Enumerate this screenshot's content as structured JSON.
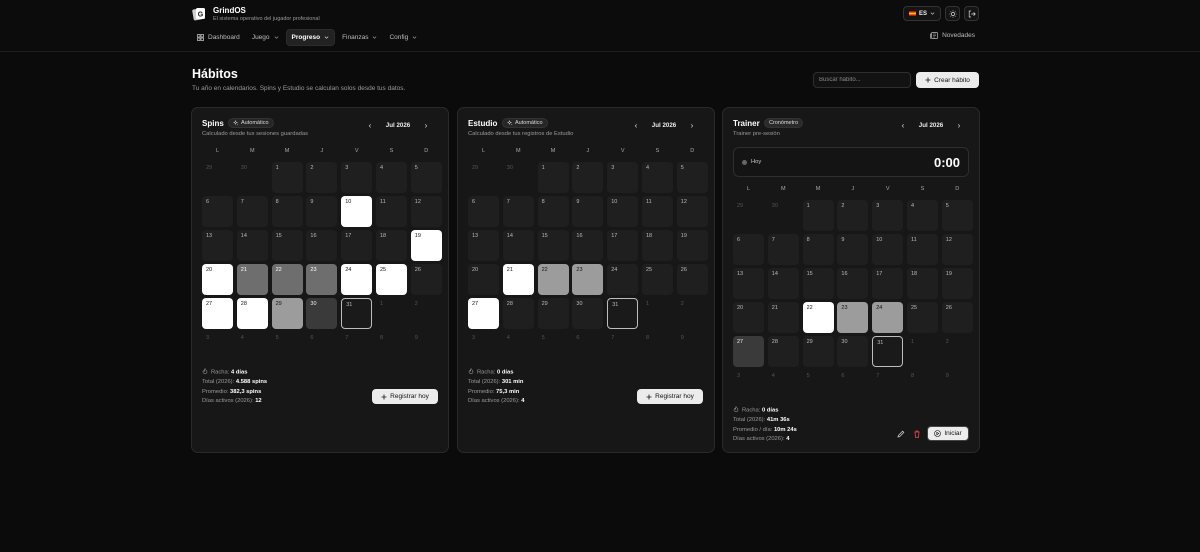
{
  "header": {
    "brand": "GrindOS",
    "tagline": "El sistema operativo del jugador profesional",
    "nav": [
      {
        "label": "Dashboard"
      },
      {
        "label": "Juego"
      },
      {
        "label": "Progreso"
      },
      {
        "label": "Finanzas"
      },
      {
        "label": "Config"
      }
    ],
    "active_nav": "Progreso",
    "language": "ES",
    "news_label": "Novedades"
  },
  "page": {
    "title": "Hábitos",
    "subtitle": "Tu año en calendarios. Spins y Estudio se calculan solos desde tus datos.",
    "search_placeholder": "Buscar hábito...",
    "create_label": "Crear hábito"
  },
  "weekdays": [
    "L",
    "M",
    "M",
    "J",
    "V",
    "S",
    "D"
  ],
  "cards": [
    {
      "title": "Spins",
      "badge": "Automático",
      "subtitle": "Calculado desde tus sesiones guardadas",
      "month": "Jul 2026",
      "days": [
        {
          "d": "29",
          "out": true
        },
        {
          "d": "30",
          "out": true
        },
        {
          "d": "1"
        },
        {
          "d": "2"
        },
        {
          "d": "3"
        },
        {
          "d": "4"
        },
        {
          "d": "5"
        },
        {
          "d": "6"
        },
        {
          "d": "7"
        },
        {
          "d": "8"
        },
        {
          "d": "9"
        },
        {
          "d": "10",
          "lvl": 4
        },
        {
          "d": "11"
        },
        {
          "d": "12"
        },
        {
          "d": "13"
        },
        {
          "d": "14"
        },
        {
          "d": "15"
        },
        {
          "d": "16"
        },
        {
          "d": "17"
        },
        {
          "d": "18"
        },
        {
          "d": "19",
          "lvl": 4
        },
        {
          "d": "20",
          "lvl": 4
        },
        {
          "d": "21",
          "lvl": 2
        },
        {
          "d": "22",
          "lvl": 2
        },
        {
          "d": "23",
          "lvl": 2
        },
        {
          "d": "24",
          "lvl": 4
        },
        {
          "d": "25",
          "lvl": 4
        },
        {
          "d": "26"
        },
        {
          "d": "27",
          "lvl": 4
        },
        {
          "d": "28",
          "lvl": 4
        },
        {
          "d": "29",
          "lvl": 3
        },
        {
          "d": "30",
          "lvl": 1
        },
        {
          "d": "31",
          "today": true
        },
        {
          "d": "1",
          "out": true
        },
        {
          "d": "2",
          "out": true
        },
        {
          "d": "3",
          "out": true
        },
        {
          "d": "4",
          "out": true
        },
        {
          "d": "5",
          "out": true
        },
        {
          "d": "6",
          "out": true
        },
        {
          "d": "7",
          "out": true
        },
        {
          "d": "8",
          "out": true
        },
        {
          "d": "9",
          "out": true
        }
      ],
      "stats": [
        {
          "label": "Racha:",
          "value": "4 días"
        },
        {
          "label": "Total (2026):",
          "value": "4.588 spins"
        },
        {
          "label": "Promedio:",
          "value": "382,3 spins"
        },
        {
          "label": "Días activos (2026):",
          "value": "12"
        }
      ],
      "action": "Registrar hoy"
    },
    {
      "title": "Estudio",
      "badge": "Automático",
      "subtitle": "Calculado desde tus registros de Estudio",
      "month": "Jul 2026",
      "days": [
        {
          "d": "29",
          "out": true
        },
        {
          "d": "30",
          "out": true
        },
        {
          "d": "1"
        },
        {
          "d": "2"
        },
        {
          "d": "3"
        },
        {
          "d": "4"
        },
        {
          "d": "5"
        },
        {
          "d": "6"
        },
        {
          "d": "7"
        },
        {
          "d": "8"
        },
        {
          "d": "9"
        },
        {
          "d": "10"
        },
        {
          "d": "11"
        },
        {
          "d": "12"
        },
        {
          "d": "13"
        },
        {
          "d": "14"
        },
        {
          "d": "15"
        },
        {
          "d": "16"
        },
        {
          "d": "17"
        },
        {
          "d": "18"
        },
        {
          "d": "19"
        },
        {
          "d": "20"
        },
        {
          "d": "21",
          "lvl": 4
        },
        {
          "d": "22",
          "lvl": 3
        },
        {
          "d": "23",
          "lvl": 3
        },
        {
          "d": "24"
        },
        {
          "d": "25"
        },
        {
          "d": "26"
        },
        {
          "d": "27",
          "lvl": 4
        },
        {
          "d": "28"
        },
        {
          "d": "29"
        },
        {
          "d": "30"
        },
        {
          "d": "31",
          "today": true
        },
        {
          "d": "1",
          "out": true
        },
        {
          "d": "2",
          "out": true
        },
        {
          "d": "3",
          "out": true
        },
        {
          "d": "4",
          "out": true
        },
        {
          "d": "5",
          "out": true
        },
        {
          "d": "6",
          "out": true
        },
        {
          "d": "7",
          "out": true
        },
        {
          "d": "8",
          "out": true
        },
        {
          "d": "9",
          "out": true
        }
      ],
      "stats": [
        {
          "label": "Racha:",
          "value": "0 días"
        },
        {
          "label": "Total (2026):",
          "value": "301 min"
        },
        {
          "label": "Promedio:",
          "value": "75,3 min"
        },
        {
          "label": "Días activos (2026):",
          "value": "4"
        }
      ],
      "action": "Registrar hoy"
    },
    {
      "title": "Trainer",
      "badge": "Cronómetro",
      "subtitle": "Trainer pre-sesión",
      "month": "Jul 2026",
      "timer": {
        "label": "Hoy",
        "value": "0:00"
      },
      "days": [
        {
          "d": "29",
          "out": true
        },
        {
          "d": "30",
          "out": true
        },
        {
          "d": "1"
        },
        {
          "d": "2"
        },
        {
          "d": "3"
        },
        {
          "d": "4"
        },
        {
          "d": "5"
        },
        {
          "d": "6"
        },
        {
          "d": "7"
        },
        {
          "d": "8"
        },
        {
          "d": "9"
        },
        {
          "d": "10"
        },
        {
          "d": "11"
        },
        {
          "d": "12"
        },
        {
          "d": "13"
        },
        {
          "d": "14"
        },
        {
          "d": "15"
        },
        {
          "d": "16"
        },
        {
          "d": "17"
        },
        {
          "d": "18"
        },
        {
          "d": "19"
        },
        {
          "d": "20"
        },
        {
          "d": "21"
        },
        {
          "d": "22",
          "lvl": 4
        },
        {
          "d": "23",
          "lvl": 3
        },
        {
          "d": "24",
          "lvl": 3
        },
        {
          "d": "25"
        },
        {
          "d": "26"
        },
        {
          "d": "27",
          "lvl": 1
        },
        {
          "d": "28"
        },
        {
          "d": "29"
        },
        {
          "d": "30"
        },
        {
          "d": "31",
          "today": true
        },
        {
          "d": "1",
          "out": true
        },
        {
          "d": "2",
          "out": true
        },
        {
          "d": "3",
          "out": true
        },
        {
          "d": "4",
          "out": true
        },
        {
          "d": "5",
          "out": true
        },
        {
          "d": "6",
          "out": true
        },
        {
          "d": "7",
          "out": true
        },
        {
          "d": "8",
          "out": true
        },
        {
          "d": "9",
          "out": true
        }
      ],
      "stats": [
        {
          "label": "Racha:",
          "value": "0 días"
        },
        {
          "label": "Total (2026):",
          "value": "41m 36s"
        },
        {
          "label": "Promedio / día:",
          "value": "10m 24s"
        },
        {
          "label": "Días activos (2026):",
          "value": "4"
        }
      ],
      "action": "Iniciar"
    }
  ]
}
